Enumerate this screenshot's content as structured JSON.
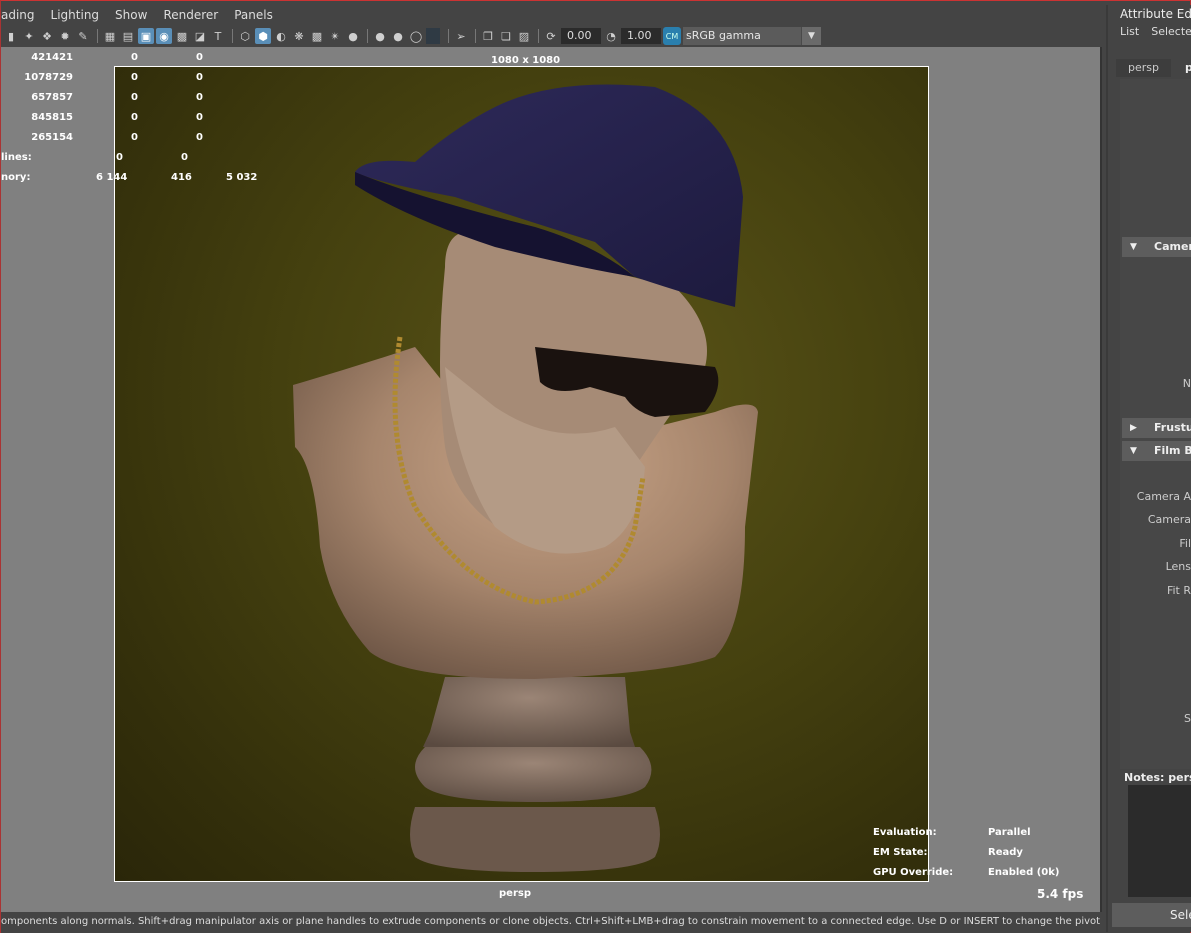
{
  "menubar": {
    "items": [
      "ading",
      "Lighting",
      "Show",
      "Renderer",
      "Panels"
    ]
  },
  "toolbar": {
    "exposure_value": "0.00",
    "gamma_value": "1.00",
    "color_space": "sRGB gamma",
    "icons": [
      "bookmark-icon",
      "camera-attributes-icon",
      "select-camera-icon",
      "camera-tumble-icon",
      "pencil-icon",
      "grid-icon",
      "film-gate-icon",
      "resolution-gate-icon",
      "gate-mask-icon",
      "field-chart-icon",
      "safe-action-icon",
      "safe-title-icon",
      "wireframe-icon",
      "smooth-shade-icon",
      "default-material-icon",
      "xray-icon",
      "textured-icon",
      "lights-icon",
      "shadows-icon",
      "screen-space-ao-icon",
      "motion-blur-icon",
      "multisample-icon",
      "depth-of-field-icon",
      "isolate-select-icon",
      "xray-joints-icon",
      "xray-active-icon",
      "xray-toggle-icon",
      "exposure-icon",
      "gamma-icon",
      "color-management-icon"
    ]
  },
  "viewport": {
    "gate_label": "1080 x 1080",
    "camera_label": "persp",
    "fps": "5.4 fps",
    "hud_stats": [
      {
        "label": "",
        "c1": "421421",
        "c2": "0",
        "c3": "0"
      },
      {
        "label": "",
        "c1": "1078729",
        "c2": "0",
        "c3": "0"
      },
      {
        "label": "",
        "c1": "657857",
        "c2": "0",
        "c3": "0"
      },
      {
        "label": "",
        "c1": "845815",
        "c2": "0",
        "c3": "0"
      },
      {
        "label": "",
        "c1": "265154",
        "c2": "0",
        "c3": "0"
      }
    ],
    "hud_lines": {
      "label": "lines:",
      "c1": "0",
      "c2": "0"
    },
    "hud_memory": {
      "label": "nory:",
      "c1": "6 144",
      "c2": "416",
      "c3": "5 032"
    },
    "hud_status": [
      {
        "label": "Evaluation:",
        "value": "Parallel"
      },
      {
        "label": "EM State:",
        "value": "Ready"
      },
      {
        "label": "GPU Override:",
        "value": "Enabled (0k)"
      }
    ]
  },
  "statusbar": {
    "text": "omponents along normals. Shift+drag manipulator axis or plane handles to extrude components or clone objects. Ctrl+Shift+LMB+drag to constrain movement to a connected edge. Use D or INSERT to change the pivot position and axis orientation."
  },
  "attribute_editor": {
    "title": "Attribute Edito",
    "menu": [
      "List",
      "Selected"
    ],
    "tabs": [
      "persp",
      "pe"
    ],
    "sections": [
      {
        "label": "Camera",
        "expanded": true
      },
      {
        "label": "Frustum",
        "expanded": false
      },
      {
        "label": "Film Ba",
        "expanded": true
      }
    ],
    "fields": [
      "N",
      "Camera A",
      "Camera",
      "Fil",
      "Lens",
      "Fit R",
      "S"
    ],
    "notes_label": "Notes:  persp",
    "select_button": "Sele"
  }
}
